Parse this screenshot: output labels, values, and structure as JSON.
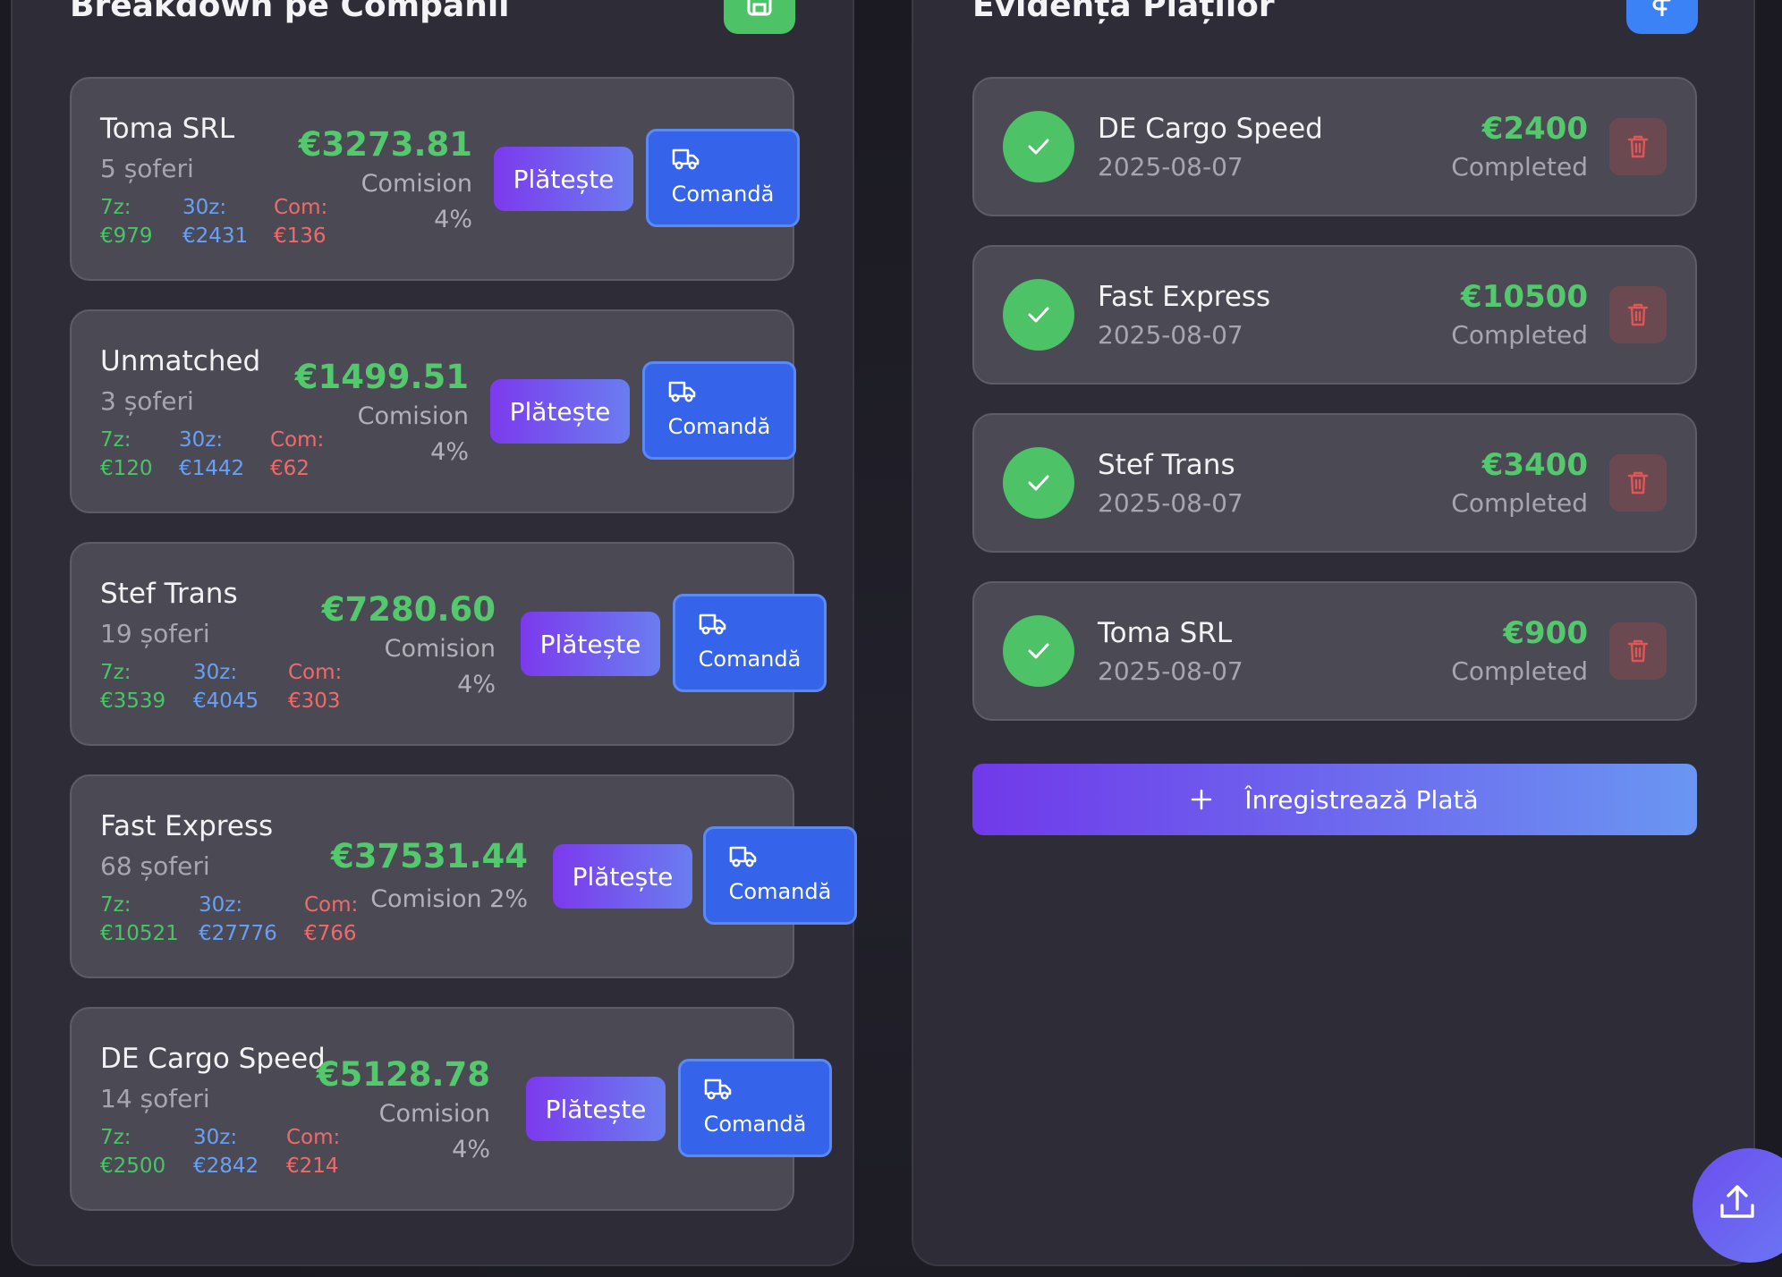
{
  "left_panel": {
    "title": "Breakdown pe Companii",
    "head_button_icon": "save-icon",
    "companies": [
      {
        "name": "Toma SRL",
        "drivers": "5 șoferi",
        "amount": "€3273.81",
        "commission_line1": "Comision",
        "commission_line2": "4%",
        "stat7_label": "7z:",
        "stat7_value": "€979",
        "stat30_label": "30z:",
        "stat30_value": "€2431",
        "com_label": "Com:",
        "com_value": "€136",
        "pay_label": "Plătește",
        "order_label": "Comandă"
      },
      {
        "name": "Unmatched",
        "drivers": "3 șoferi",
        "amount": "€1499.51",
        "commission_line1": "Comision",
        "commission_line2": "4%",
        "stat7_label": "7z:",
        "stat7_value": "€120",
        "stat30_label": "30z:",
        "stat30_value": "€1442",
        "com_label": "Com:",
        "com_value": "€62",
        "pay_label": "Plătește",
        "order_label": "Comandă"
      },
      {
        "name": "Stef Trans",
        "drivers": "19 șoferi",
        "amount": "€7280.60",
        "commission_line1": "Comision",
        "commission_line2": "4%",
        "stat7_label": "7z:",
        "stat7_value": "€3539",
        "stat30_label": "30z:",
        "stat30_value": "€4045",
        "com_label": "Com:",
        "com_value": "€303",
        "pay_label": "Plătește",
        "order_label": "Comandă"
      },
      {
        "name": "Fast Express",
        "drivers": "68 șoferi",
        "amount": "€37531.44",
        "commission_line1": "Comision 2%",
        "commission_line2": "",
        "stat7_label": "7z:",
        "stat7_value": "€10521",
        "stat30_label": "30z:",
        "stat30_value": "€27776",
        "com_label": "Com:",
        "com_value": "€766",
        "pay_label": "Plătește",
        "order_label": "Comandă"
      },
      {
        "name": "DE Cargo Speed",
        "drivers": "14 șoferi",
        "amount": "€5128.78",
        "commission_line1": "Comision",
        "commission_line2": "4%",
        "stat7_label": "7z:",
        "stat7_value": "€2500",
        "stat30_label": "30z:",
        "stat30_value": "€2842",
        "com_label": "Com:",
        "com_value": "€214",
        "pay_label": "Plătește",
        "order_label": "Comandă"
      }
    ]
  },
  "right_panel": {
    "title": "Evidența Plăților",
    "head_button_icon": "dollar-icon",
    "payments": [
      {
        "name": "DE Cargo Speed",
        "date": "2025-08-07",
        "amount": "€2400",
        "status": "Completed"
      },
      {
        "name": "Fast Express",
        "date": "2025-08-07",
        "amount": "€10500",
        "status": "Completed"
      },
      {
        "name": "Stef Trans",
        "date": "2025-08-07",
        "amount": "€3400",
        "status": "Completed"
      },
      {
        "name": "Toma SRL",
        "date": "2025-08-07",
        "amount": "€900",
        "status": "Completed"
      }
    ],
    "register_label": "Înregistrează Plată",
    "register_icon": "plus-icon"
  },
  "fab_icon": "upload-icon",
  "colors": {
    "green": "#4ec267",
    "blue": "#3b82f6",
    "purple": "#7c3aed",
    "red": "#ef6b6b"
  }
}
